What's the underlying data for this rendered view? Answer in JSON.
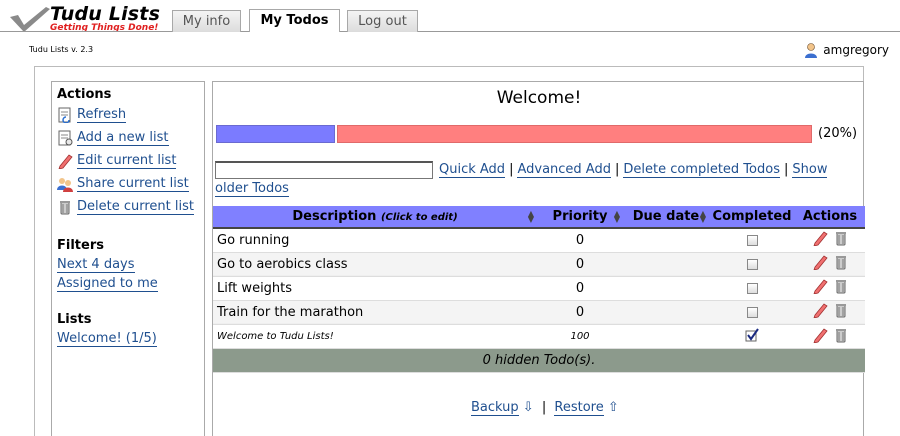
{
  "app": {
    "title": "Tudu Lists",
    "tagline": "Getting Things Done!",
    "version": "Tudu Lists v. 2.3"
  },
  "tabs": [
    {
      "label": "My info",
      "active": false
    },
    {
      "label": "My Todos",
      "active": true
    },
    {
      "label": "Log out",
      "active": false
    }
  ],
  "user": {
    "name": "amgregory",
    "icon": "user-icon"
  },
  "sidebar": {
    "actions_heading": "Actions",
    "actions": [
      {
        "label": "Refresh",
        "icon": "refresh-icon"
      },
      {
        "label": "Add a new list",
        "icon": "new-list-icon"
      },
      {
        "label": "Edit current list",
        "icon": "pencil-icon"
      },
      {
        "label": "Share current list",
        "icon": "share-icon"
      },
      {
        "label": "Delete current list",
        "icon": "trash-icon"
      }
    ],
    "filters_heading": "Filters",
    "filters": [
      "Next 4 days",
      "Assigned to me"
    ],
    "lists_heading": "Lists",
    "lists": [
      "Welcome! (1/5)"
    ]
  },
  "main": {
    "welcome": "Welcome!",
    "progress": {
      "fraction": 0.2,
      "label": "(20%)",
      "done_color": "#7b7bff",
      "todo_color": "#ff7f7f"
    },
    "quick_add_value": "",
    "links": {
      "quick_add": "Quick Add",
      "advanced_add": "Advanced Add",
      "delete_completed": "Delete completed Todos",
      "show": "Show",
      "older": "older Todos"
    },
    "table": {
      "header_bg": "#8080ff",
      "columns": {
        "description": "Description",
        "description_hint": "(Click to edit)",
        "priority": "Priority",
        "due_date": "Due date",
        "completed": "Completed",
        "actions": "Actions"
      },
      "rows": [
        {
          "description": "Go running",
          "priority": "0",
          "due": "",
          "completed": false
        },
        {
          "description": "Go to aerobics class",
          "priority": "0",
          "due": "",
          "completed": false
        },
        {
          "description": "Lift weights",
          "priority": "0",
          "due": "",
          "completed": false
        },
        {
          "description": "Train for the marathon",
          "priority": "0",
          "due": "",
          "completed": false
        },
        {
          "description": "Welcome to Tudu Lists!",
          "priority": "100",
          "due": "",
          "completed": true
        }
      ],
      "hidden_text": "0 hidden Todo(s)."
    },
    "footer": {
      "backup": "Backup",
      "restore": "Restore"
    }
  }
}
